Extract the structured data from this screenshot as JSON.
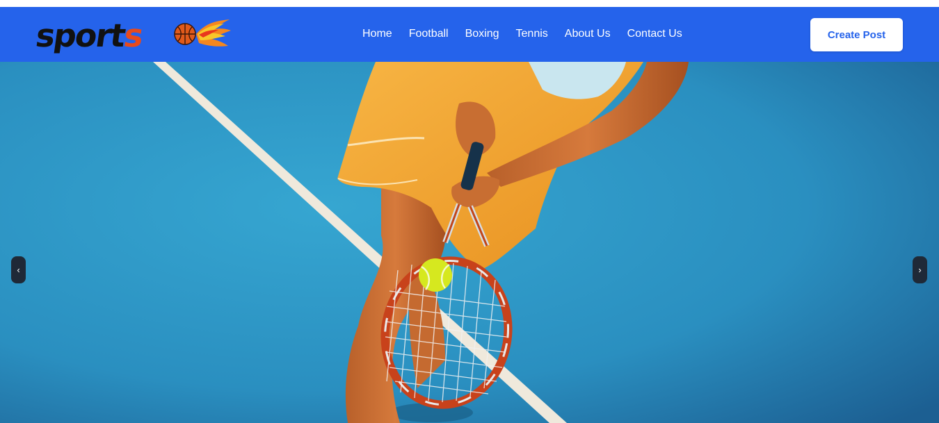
{
  "brand": {
    "logo_text_main": "sport",
    "logo_text_last": "s",
    "icon": "basketball-flame-icon"
  },
  "nav": {
    "items": [
      {
        "label": "Home"
      },
      {
        "label": "Football"
      },
      {
        "label": "Boxing"
      },
      {
        "label": "Tennis"
      },
      {
        "label": "About Us"
      },
      {
        "label": "Contact Us"
      }
    ],
    "cta_label": "Create Post"
  },
  "carousel": {
    "prev_glyph": "‹",
    "next_glyph": "›",
    "slide_image": "tennis-player-hitting-ball-image"
  },
  "colors": {
    "nav_bg": "#2563eb",
    "cta_text": "#2563eb",
    "court_blue": "#2a8fc0",
    "dress_orange": "#f0a531",
    "logo_accent": "#e84a1b"
  }
}
